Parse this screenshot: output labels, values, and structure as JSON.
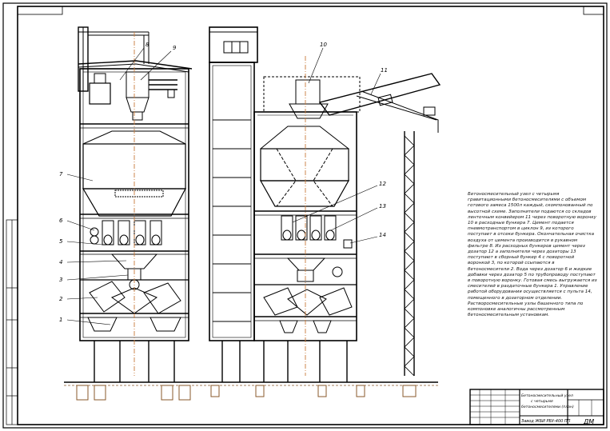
{
  "drawing": {
    "description": "Бетоносмесительный узел с четырьмя гравитационными бетоносмесителями с объемом готового замеса 1500л каждый, скомпонованный по высотной схеме. Заполнители подаются со складов ленточным конвейером 11 через поворотную воронку 10 в расходные бункера 7. Цемент подается пневмотранспортом в циклон 9, из которого поступает в отсеки бункера. Окончательная очистка воздуха от цемента производится в рукавном фильтре 8. Из расходных бункеров цемент через дозатор 12 а заполнители через дозаторы 13 поступают в сборный бункер 4 с поворотной воронкой 3, по которой ссыпаются в бетоносмесители 2. Вода через дозатор 6 и жидкие добавки через дозатор 5 по трубопроводу поступают в поворотную воронку. Готовая смесь выгружается из смесителей в раздаточные бункера 1. Управление работой оборудования осуществляется с пульта 14, помещенного в дозаторном отделении. Растворосмесительные узлы башенного типа по компоновке аналогичны рассмотренным бетоносмесительным установкам.",
    "left_callouts": [
      "8",
      "9",
      "7",
      "6",
      "5",
      "4",
      "3",
      "2",
      "1"
    ],
    "right_callouts": [
      "10",
      "11",
      "12",
      "13",
      "14"
    ],
    "title_block": {
      "title_line1": "Бетоносмесительный узел",
      "title_line2": "с четырьмя",
      "title_line3": "бетоносмесителями (план)",
      "org": "Завод ЖБИ РБУ-400 ПП",
      "sheet_code": "ДМ"
    }
  },
  "colors": {
    "line": "#000000",
    "accent": "#c87a3a",
    "ground": "#8a5a2b"
  }
}
